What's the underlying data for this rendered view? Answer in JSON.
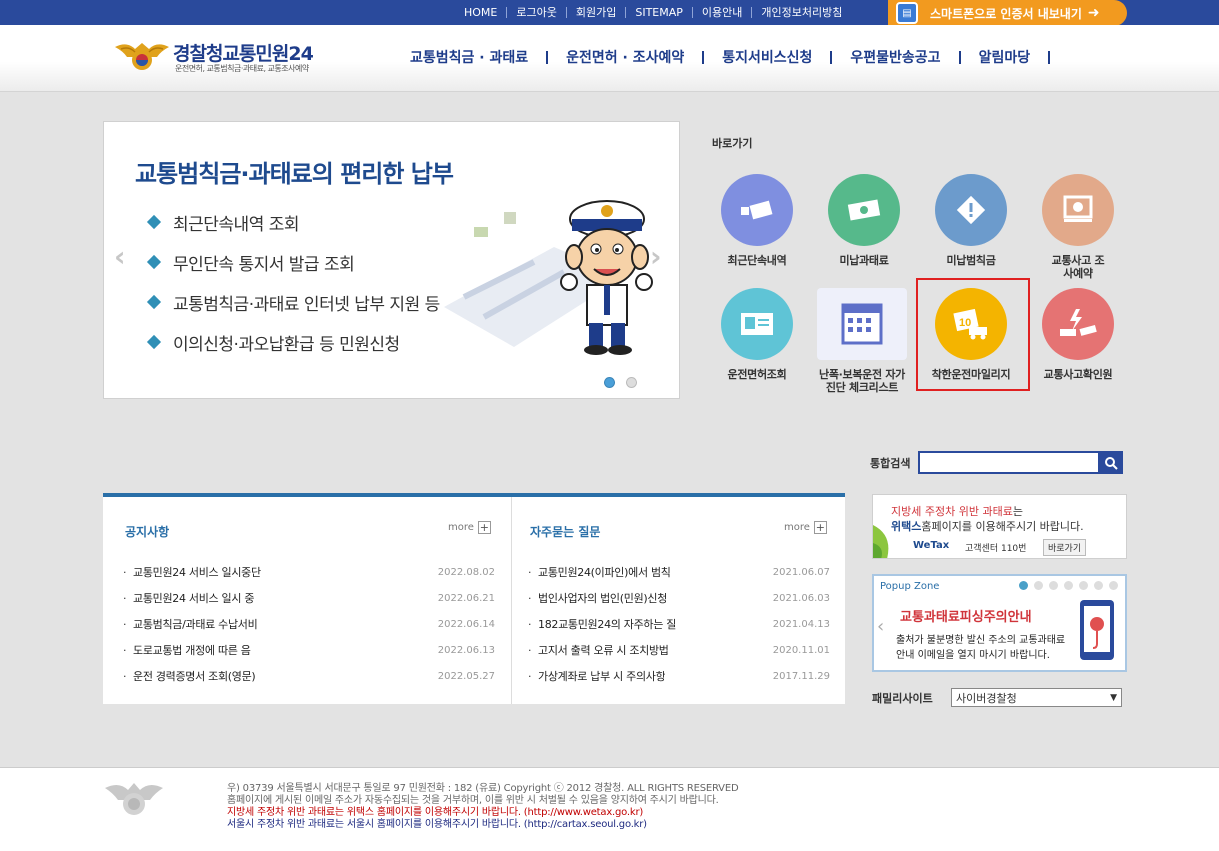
{
  "topbar": {
    "links": [
      "HOME",
      "로그아웃",
      "회원가입",
      "SITEMAP",
      "이용안내",
      "개인정보처리방침"
    ],
    "smart_label": "스마트폰으로 인증서 내보내기"
  },
  "header": {
    "logo_title_a": "경찰청",
    "logo_title_b": "교통민원24",
    "logo_sub": "운전면허, 교통범칙금·과태료, 교통조사예약",
    "nav": [
      "교통범칙금 · 과태료",
      "운전면허 · 조사예약",
      "통지서비스신청",
      "우편물반송공고",
      "알림마당"
    ]
  },
  "banner": {
    "title": "교통범칙금·과태료의 편리한 납부",
    "items": [
      "최근단속내역 조회",
      "무인단속 통지서 발급 조회",
      "교통범칙금·과태료 인터넷 납부 지원 등",
      "이의신청·과오납환급 등 민원신청"
    ],
    "prev_icon": "chevron-left-icon",
    "next_icon": "chevron-right-icon"
  },
  "quick": {
    "title": "바로가기",
    "items": [
      {
        "label": "최근단속내역",
        "color": "#7f8fe0",
        "icon": "camera-icon"
      },
      {
        "label": "미납과태료",
        "color": "#56b98b",
        "icon": "money-icon"
      },
      {
        "label": "미납범칙금",
        "color": "#6c9bcc",
        "icon": "warning-icon"
      },
      {
        "label": "교통사고 조사예약",
        "color": "#e2a98a",
        "icon": "monitor-icon"
      },
      {
        "label": "운전면허조회",
        "color": "#5fc4d6",
        "icon": "license-icon"
      },
      {
        "label": "난폭·보복운전 자가진단 체크리스트",
        "color": "#7f8fe0",
        "icon": "calendar-icon"
      },
      {
        "label": "착한운전마일리지",
        "color": "#f4b400",
        "icon": "mileage-icon"
      },
      {
        "label": "교통사고확인원",
        "color": "#e57373",
        "icon": "accident-icon"
      }
    ]
  },
  "search": {
    "label": "통합검색",
    "value": ""
  },
  "notice": {
    "title": "공지사항",
    "more": "more",
    "items": [
      {
        "title": "교통민원24 서비스 일시중단",
        "date": "2022.08.02"
      },
      {
        "title": "교통민원24 서비스 일시 중",
        "date": "2022.06.21"
      },
      {
        "title": "교통범칙금/과태료 수납서비",
        "date": "2022.06.14"
      },
      {
        "title": "도로교통법 개정에 따른 음",
        "date": "2022.06.13"
      },
      {
        "title": "운전 경력증명서 조회(영문)",
        "date": "2022.05.27"
      }
    ]
  },
  "faq": {
    "title": "자주묻는 질문",
    "more": "more",
    "items": [
      {
        "title": "교통민원24(이파인)에서 범칙",
        "date": "2021.06.07"
      },
      {
        "title": "법인사업자의 법인(민원)신청",
        "date": "2021.06.03"
      },
      {
        "title": "182교통민원24의 자주하는 질",
        "date": "2021.04.13"
      },
      {
        "title": "고지서 출력 오류 시 조치방법",
        "date": "2020.11.01"
      },
      {
        "title": "가상계좌로 납부 시 주의사항",
        "date": "2017.11.29"
      }
    ]
  },
  "wetax": {
    "line1_red": "지방세 주정차 위반 과태료",
    "line1_rest": "는",
    "line2_bold": "위택스",
    "line2_rest": "홈페이지를 이용해주시기 바랍니다.",
    "logo": "WeTax",
    "center": "고객센터 110번",
    "go": "바로가기"
  },
  "popup": {
    "title": "Popup Zone",
    "head": "교통과태료피싱주의안내",
    "line1": "출처가 불분명한 발신 주소의 교통과태료",
    "line2": "안내 이메일을 열지 마시기 바랍니다."
  },
  "family": {
    "label": "패밀리사이트",
    "selected": "사이버경찰청"
  },
  "footer": {
    "line1": "우) 03739 서울특별시 서대문구 통일로 97  민원전화 : 182 (유료)       Copyright ⓒ 2012 경찰청. ALL RIGHTS RESERVED",
    "line2": "홈페이지에 게시된 이메일 주소가 자동수집되는 것을 거부하며, 이를 위반 시 처벌될 수 있음을 양지하여 주시기 바랍니다.",
    "line3": "지방세 주정차 위반 과태료는 위택스 홈페이지를 이용해주시기 바랍니다. (http://www.wetax.go.kr)",
    "line4": "서울시 주정차 위반 과태료는 서울시 홈페이지를 이용해주시기 바랍니다. (http://cartax.seoul.go.kr)"
  }
}
